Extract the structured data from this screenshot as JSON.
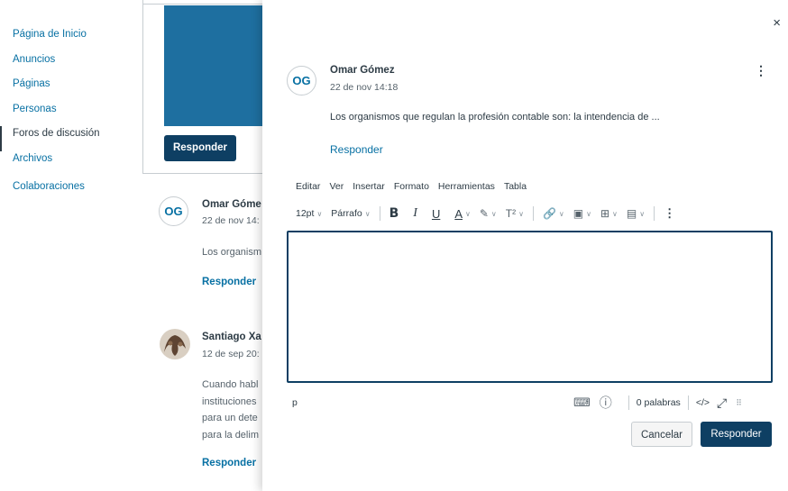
{
  "course_nav": {
    "items": [
      {
        "label": "Página de Inicio"
      },
      {
        "label": "Anuncios"
      },
      {
        "label": "Páginas"
      },
      {
        "label": "Personas"
      },
      {
        "label": "Foros de discusión",
        "active": true
      },
      {
        "label": "Archivos"
      },
      {
        "label": "Colaboraciones"
      }
    ]
  },
  "background": {
    "reply_button": "Responder",
    "entries": [
      {
        "avatar_initials": "OG",
        "author": "Omar Góme",
        "date": "22 de nov 14:",
        "text_lines": [
          "Los organism"
        ],
        "reply_link": "Responder"
      },
      {
        "author": "Santiago Xa",
        "date": "12 de sep 20:",
        "text_lines": [
          "Cuando habl",
          "instituciones",
          "para un dete",
          "para la delim"
        ],
        "reply_link": "Responder"
      }
    ]
  },
  "tray": {
    "close_icon": "×",
    "post": {
      "avatar_initials": "OG",
      "author": "Omar Gómez",
      "date": "22 de nov 14:18",
      "message": "Los organismos que regulan la profesión contable son: la intendencia de ...",
      "reply_link": "Responder"
    },
    "editor": {
      "menu": [
        "Editar",
        "Ver",
        "Insertar",
        "Formato",
        "Herramientas",
        "Tabla"
      ],
      "font_size": "12pt",
      "block_format": "Párrafo",
      "toolbar": {
        "bold": "B",
        "italic": "I",
        "underline": "U",
        "text_color": "A",
        "highlight": "✎",
        "superscript": "T²",
        "link": "🔗",
        "image": "▣",
        "media": "⊞",
        "document": "▤",
        "more": "⋮"
      },
      "status_path": "p",
      "word_count": "0 palabras",
      "html_toggle": "</>",
      "fullscreen": "⤢",
      "grip": "⠿"
    },
    "buttons": {
      "cancel": "Cancelar",
      "submit": "Responder"
    }
  },
  "colors": {
    "link": "#0770a3",
    "primary_dark": "#0e3f63",
    "banner": "#1e6fa0"
  }
}
